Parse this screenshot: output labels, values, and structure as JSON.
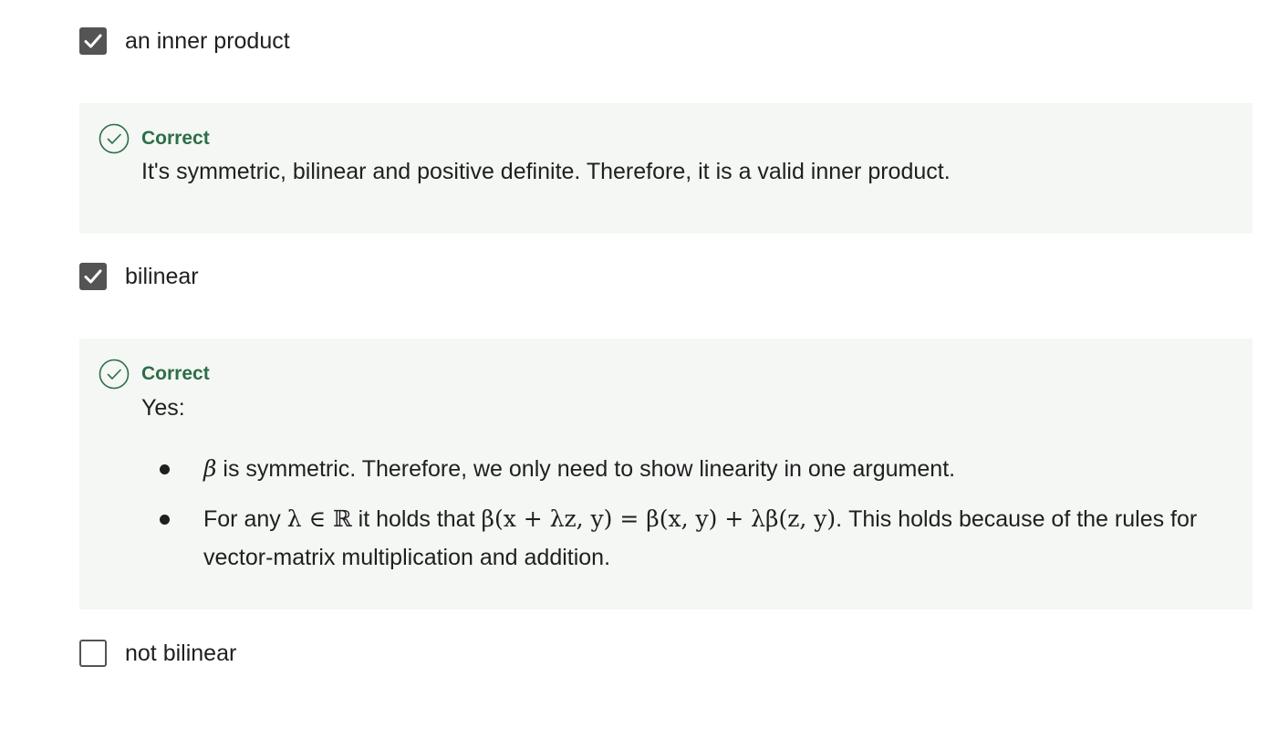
{
  "options": [
    {
      "label": "an inner product",
      "checked": true
    },
    {
      "label": "bilinear",
      "checked": true
    },
    {
      "label": "not bilinear",
      "checked": false
    }
  ],
  "feedback": [
    {
      "status": "Correct",
      "text": "It's symmetric, bilinear and positive definite. Therefore, it is a valid inner product."
    },
    {
      "status": "Correct",
      "intro": "Yes:",
      "bullets": [
        {
          "math_beta": "β",
          "text": " is symmetric. Therefore, we only need to show linearity in one argument."
        },
        {
          "prefix": "For any ",
          "math_lambda_in_R": "λ ∈ ℝ",
          "middle": " it holds that ",
          "math_equation": "β(x + λz, y) = β(x, y) + λβ(z, y)",
          "suffix": ". This holds because of the rules for vector-matrix multiplication and addition."
        }
      ]
    }
  ],
  "colors": {
    "checkbox": "#545454",
    "correct_green": "#2c6e47",
    "feedback_bg": "#f4f7f4",
    "text": "#1f1f1f"
  },
  "icons": {
    "check": "check-icon",
    "correct": "check-circle-icon"
  }
}
